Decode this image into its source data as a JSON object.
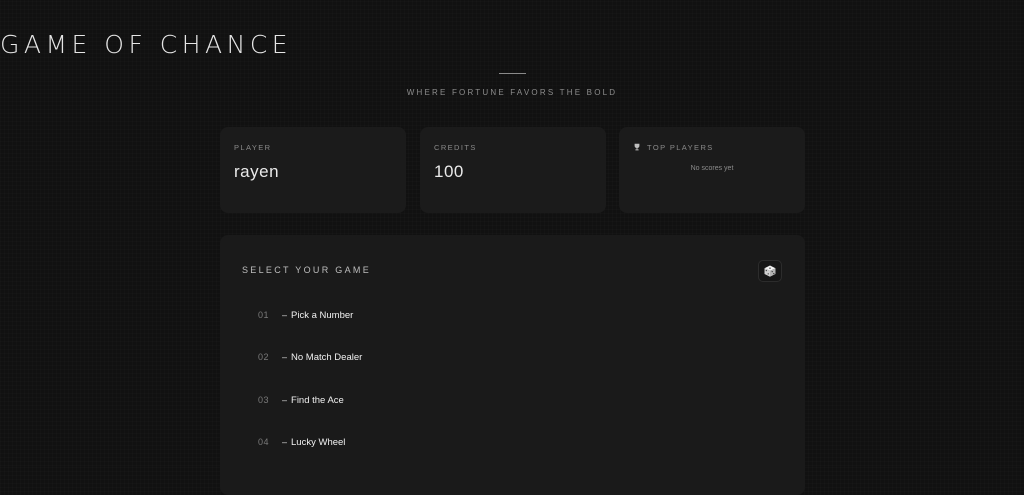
{
  "header": {
    "title": "GAME OF CHANCE",
    "subtitle": "WHERE FORTUNE FAVORS THE BOLD"
  },
  "stats": {
    "player": {
      "label": "PLAYER",
      "value": "rayen"
    },
    "credits": {
      "label": "CREDITS",
      "value": "100"
    },
    "top_players": {
      "label": "TOP PLAYERS",
      "icon": "trophy-icon",
      "empty_text": "No scores yet"
    }
  },
  "games": {
    "title": "SELECT YOUR GAME",
    "action_icon": "dice-icon",
    "items": [
      {
        "number": "01",
        "dash": "–",
        "name": "Pick a Number"
      },
      {
        "number": "02",
        "dash": "–",
        "name": "No Match Dealer"
      },
      {
        "number": "03",
        "dash": "–",
        "name": "Find the Ace"
      },
      {
        "number": "04",
        "dash": "–",
        "name": "Lucky Wheel"
      }
    ]
  },
  "colors": {
    "background": "#111111",
    "card": "#1b1b1b",
    "text": "#e8e8e8",
    "muted": "#8a8a8a"
  }
}
